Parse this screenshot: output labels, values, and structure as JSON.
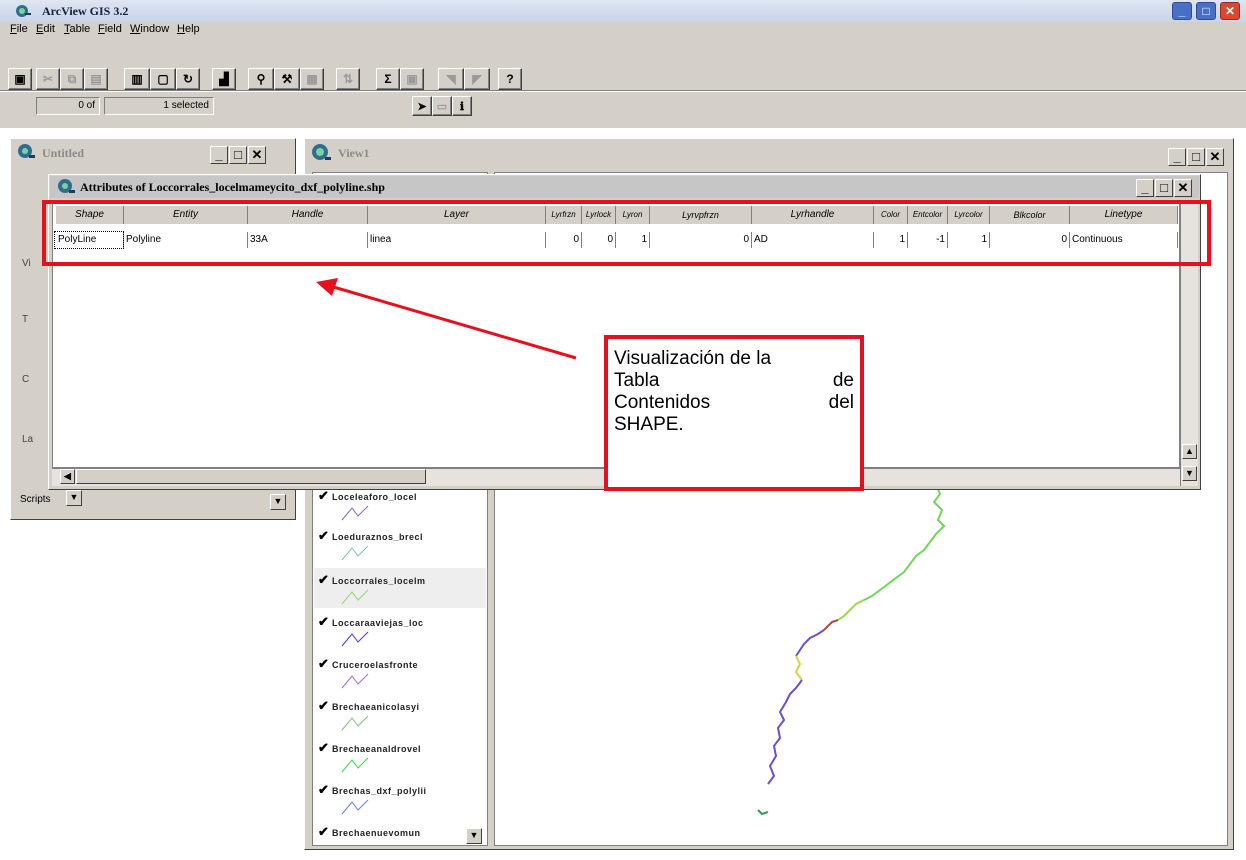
{
  "app": {
    "title": "ArcView GIS 3.2"
  },
  "menu": [
    "File",
    "Edit",
    "Table",
    "Field",
    "Window",
    "Help"
  ],
  "toolbar": {
    "buttons": [
      "save-icon",
      "cut-icon",
      "copy-icon",
      "paste-icon",
      "column-left-icon",
      "column-right-icon",
      "refresh-icon",
      "chart-icon",
      "find-icon",
      "query-icon",
      "promote-icon",
      "sort-icon",
      "sum-icon",
      "join-icon",
      "arrow-icon",
      "help-icon"
    ],
    "selection_count": "0 of",
    "selection_total": "1 selected"
  },
  "project_window": {
    "title": "Untitled",
    "scripts_label": "Scripts"
  },
  "view_window": {
    "title": "View1",
    "legend": [
      "Loceleaforo_locel",
      "Loeduraznos_brecl",
      "Loccorrales_locelm",
      "Loccaraaviejas_loc",
      "Cruceroelasfronte",
      "Brechaeanicolasyi",
      "Brechaeanaldrovel",
      "Brechas_dxf_polylii",
      "Brechaenuevomun"
    ]
  },
  "attribute_table": {
    "title": "Attributes of Loccorrales_locelmameycito_dxf_polyline.shp",
    "columns": [
      "Shape",
      "Entity",
      "Handle",
      "Layer",
      "Lyrfrzn",
      "Lyrlock",
      "Lyron",
      "Lyrvpfrzn",
      "Lyrhandle",
      "Color",
      "Entcolor",
      "Lyrcolor",
      "Blkcolor",
      "Linetype"
    ],
    "rows": [
      [
        "PolyLine",
        "Polyline",
        "33A",
        "linea",
        "0",
        "0",
        "1",
        "0",
        "AD",
        "1",
        "-1",
        "1",
        "0",
        "Continuous"
      ]
    ]
  },
  "annotation": {
    "lines": [
      "Visualización de la",
      "Tabla de",
      "Contenidos del",
      "SHAPE."
    ],
    "line2_left": "Tabla",
    "line2_right": "de",
    "line3_left": "Contenidos",
    "line3_right": "del",
    "color": "#e8101c"
  },
  "map_colors": [
    "#6fd65a",
    "#9ad94a",
    "#b04a3c",
    "#6a4fd6",
    "#d6d63c",
    "#2c9c5c"
  ]
}
